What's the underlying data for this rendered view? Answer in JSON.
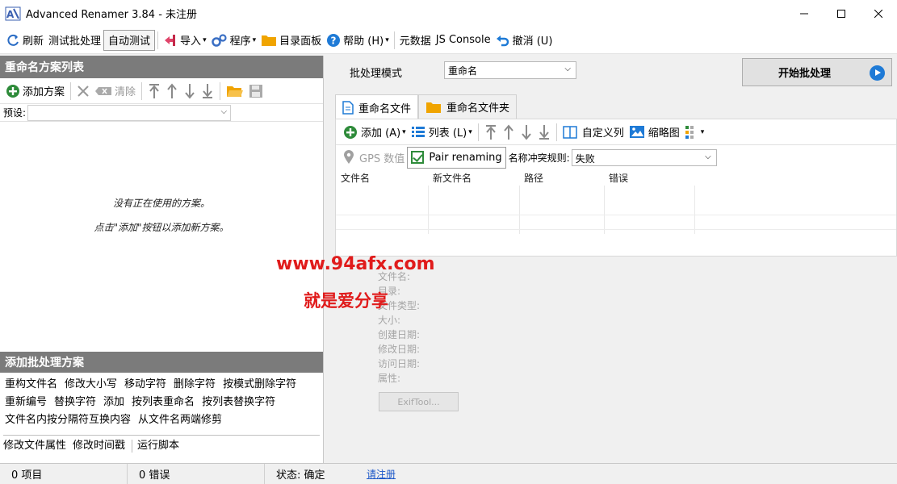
{
  "window": {
    "title": "Advanced Renamer 3.84 - 未注册"
  },
  "toolbar": {
    "refresh": "刷新",
    "test_batch": "测试批处理",
    "auto_test": "自动测试",
    "import": "导入",
    "program": "程序",
    "dir_panel": "目录面板",
    "help": "帮助 (H)",
    "metadata": "元数据",
    "js_console": "JS Console",
    "undo": "撤消 (U)"
  },
  "left": {
    "methods_header": "重命名方案列表",
    "add_method": "添加方案",
    "clear": "清除",
    "preset_label": "预设:",
    "empty_msg1": "没有正在使用的方案。",
    "empty_msg2": "点击\"添加\"按钮以添加新方案。",
    "add_batch_header": "添加批处理方案",
    "method_rows": [
      [
        "重构文件名",
        "修改大小写",
        "移动字符",
        "删除字符",
        "按模式删除字符"
      ],
      [
        "重新编号",
        "替换字符",
        "添加",
        "按列表重命名",
        "按列表替换字符"
      ],
      [
        "文件名内按分隔符互换内容",
        "从文件名两端修剪"
      ]
    ],
    "method_row4": [
      "修改文件属性",
      "修改时间戳",
      "运行脚本"
    ]
  },
  "right": {
    "batch_mode_label": "批处理模式",
    "batch_mode_value": "重命名",
    "start_button": "开始批处理",
    "tab_files": "重命名文件",
    "tab_folders": "重命名文件夹",
    "add": "添加 (A)",
    "list": "列表 (L)",
    "custom_columns": "自定义列",
    "thumbnails": "缩略图",
    "gps": "GPS 数值",
    "pair_renaming": "Pair renaming",
    "conflict_label": "名称冲突规则:",
    "conflict_value": "失败",
    "columns": [
      "文件名",
      "新文件名",
      "路径",
      "错误"
    ],
    "info_fields": [
      "文件名:",
      "目录:",
      "文件类型:",
      "大小:",
      "创建日期:",
      "修改日期:",
      "访问日期:",
      "属性:"
    ],
    "exif_button": "ExifTool..."
  },
  "watermark": {
    "line1": "www.94afx.com",
    "line2": "就是爱分享"
  },
  "status": {
    "items": "0 项目",
    "errors": "0 错误",
    "state": "状态: 确定",
    "register": "请注册"
  },
  "colors": {
    "panel_header": "#7b7b7b",
    "accent_blue": "#1e7ad6",
    "green": "#2e8b3a",
    "orange": "#f0a400",
    "link": "#1a56c8",
    "watermark": "#e01b1b"
  }
}
